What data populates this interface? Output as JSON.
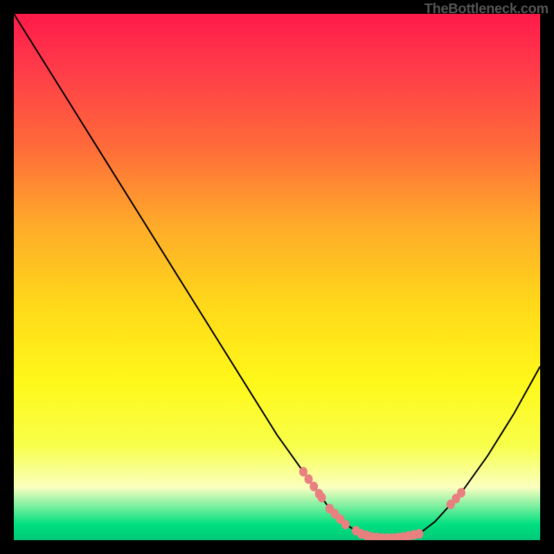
{
  "watermark": "TheBottleneck.com",
  "chart_data": {
    "type": "line",
    "title": "",
    "xlabel": "",
    "ylabel": "",
    "xlim": [
      0,
      100
    ],
    "ylim": [
      0,
      100
    ],
    "curve": [
      {
        "x": 0,
        "y": 100
      },
      {
        "x": 5,
        "y": 92
      },
      {
        "x": 10,
        "y": 84
      },
      {
        "x": 20,
        "y": 68
      },
      {
        "x": 30,
        "y": 52
      },
      {
        "x": 40,
        "y": 36
      },
      {
        "x": 50,
        "y": 20
      },
      {
        "x": 55,
        "y": 13
      },
      {
        "x": 60,
        "y": 6
      },
      {
        "x": 63,
        "y": 3
      },
      {
        "x": 66,
        "y": 1.2
      },
      {
        "x": 68,
        "y": 0.6
      },
      {
        "x": 70,
        "y": 0.4
      },
      {
        "x": 72,
        "y": 0.4
      },
      {
        "x": 74,
        "y": 0.6
      },
      {
        "x": 77,
        "y": 1.2
      },
      {
        "x": 80,
        "y": 3.5
      },
      {
        "x": 85,
        "y": 9
      },
      {
        "x": 90,
        "y": 16
      },
      {
        "x": 95,
        "y": 24
      },
      {
        "x": 100,
        "y": 33
      }
    ],
    "data_points": [
      {
        "x": 55,
        "y": 13.0
      },
      {
        "x": 56,
        "y": 11.6
      },
      {
        "x": 57,
        "y": 10.2
      },
      {
        "x": 58,
        "y": 8.8
      },
      {
        "x": 58.5,
        "y": 8.1
      },
      {
        "x": 60,
        "y": 6.0
      },
      {
        "x": 61,
        "y": 5.0
      },
      {
        "x": 62,
        "y": 4.0
      },
      {
        "x": 63,
        "y": 3.0
      },
      {
        "x": 65,
        "y": 1.8
      },
      {
        "x": 66,
        "y": 1.2
      },
      {
        "x": 67,
        "y": 0.9
      },
      {
        "x": 68,
        "y": 0.6
      },
      {
        "x": 69,
        "y": 0.5
      },
      {
        "x": 70,
        "y": 0.4
      },
      {
        "x": 71,
        "y": 0.4
      },
      {
        "x": 72,
        "y": 0.4
      },
      {
        "x": 73,
        "y": 0.5
      },
      {
        "x": 74,
        "y": 0.6
      },
      {
        "x": 75,
        "y": 0.8
      },
      {
        "x": 76,
        "y": 1.0
      },
      {
        "x": 77,
        "y": 1.2
      },
      {
        "x": 83,
        "y": 6.8
      },
      {
        "x": 84,
        "y": 7.9
      },
      {
        "x": 85,
        "y": 9.0
      }
    ],
    "point_color": "#e88080",
    "line_color": "#000000"
  }
}
